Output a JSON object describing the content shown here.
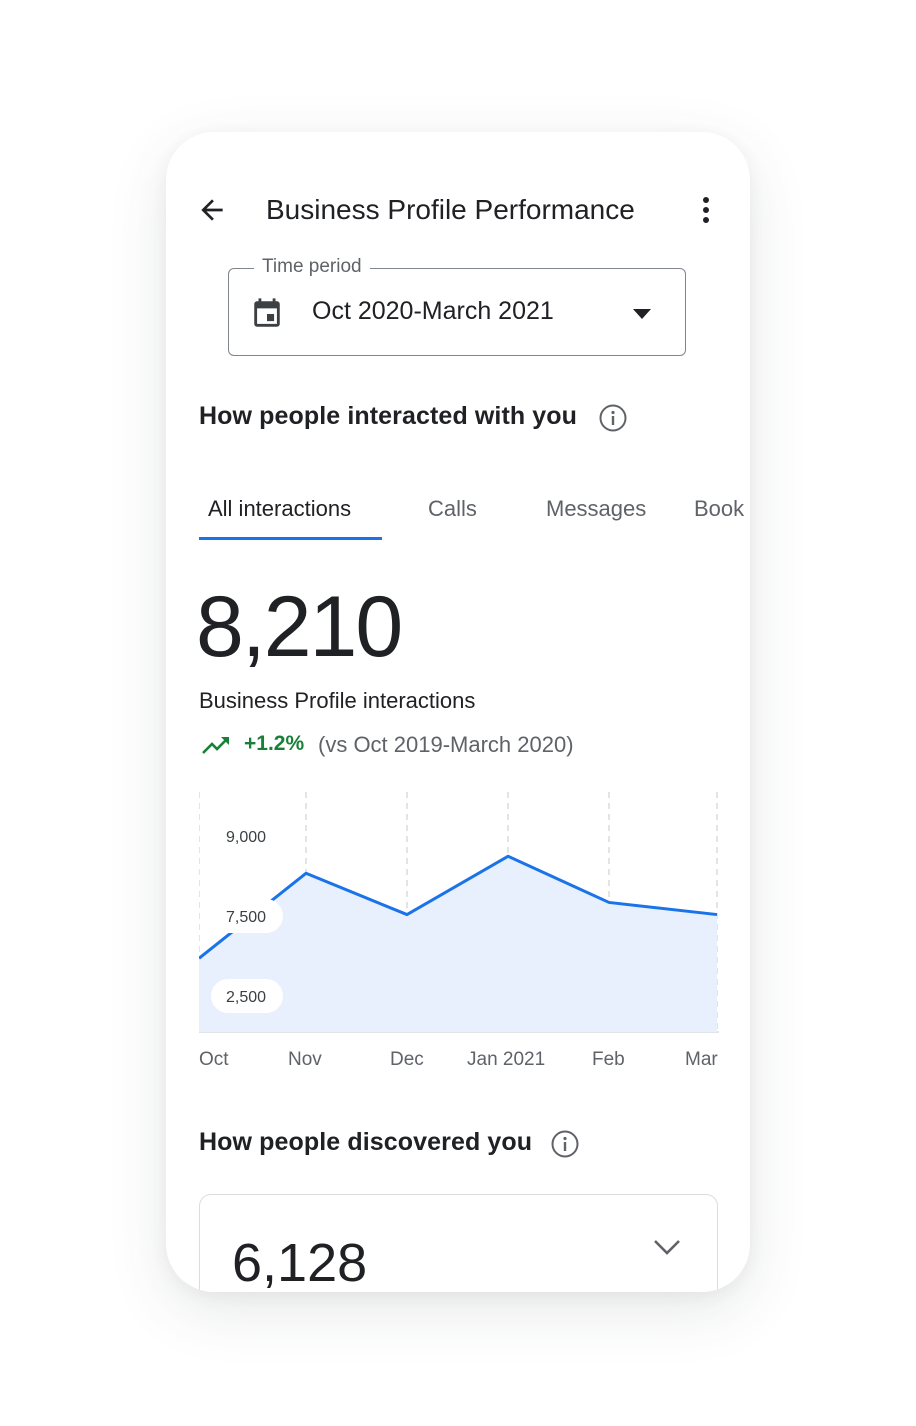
{
  "header": {
    "title": "Business Profile Performance",
    "back_icon": "arrow-back-icon",
    "more_icon": "more-vert-icon"
  },
  "time_period": {
    "label": "Time period",
    "value": "Oct 2020-March 2021",
    "icon": "calendar-icon"
  },
  "interactions": {
    "title": "How people interacted with you",
    "tabs": [
      {
        "label": "All interactions",
        "active": true
      },
      {
        "label": "Calls",
        "active": false
      },
      {
        "label": "Messages",
        "active": false
      },
      {
        "label": "Book",
        "active": false
      }
    ],
    "total": "8,210",
    "metric_label": "Business Profile interactions",
    "trend_value": "+1.2%",
    "trend_compare": "(vs Oct 2019-March 2020)",
    "trend_color": "#188038"
  },
  "chart_data": {
    "type": "area",
    "categories": [
      "Oct",
      "Nov",
      "Dec",
      "Jan 2021",
      "Feb",
      "Mar"
    ],
    "y_tick_labels": [
      "9,000",
      "7,500",
      "2,500"
    ],
    "series": [
      {
        "values": [
          6700,
          8450,
          7600,
          8800,
          7850,
          7600
        ]
      }
    ],
    "line_color": "#1a73e8",
    "fill_color": "#e8f0fe",
    "grid": "vertical dashed"
  },
  "discovery": {
    "title": "How people discovered you",
    "total": "6,128"
  }
}
